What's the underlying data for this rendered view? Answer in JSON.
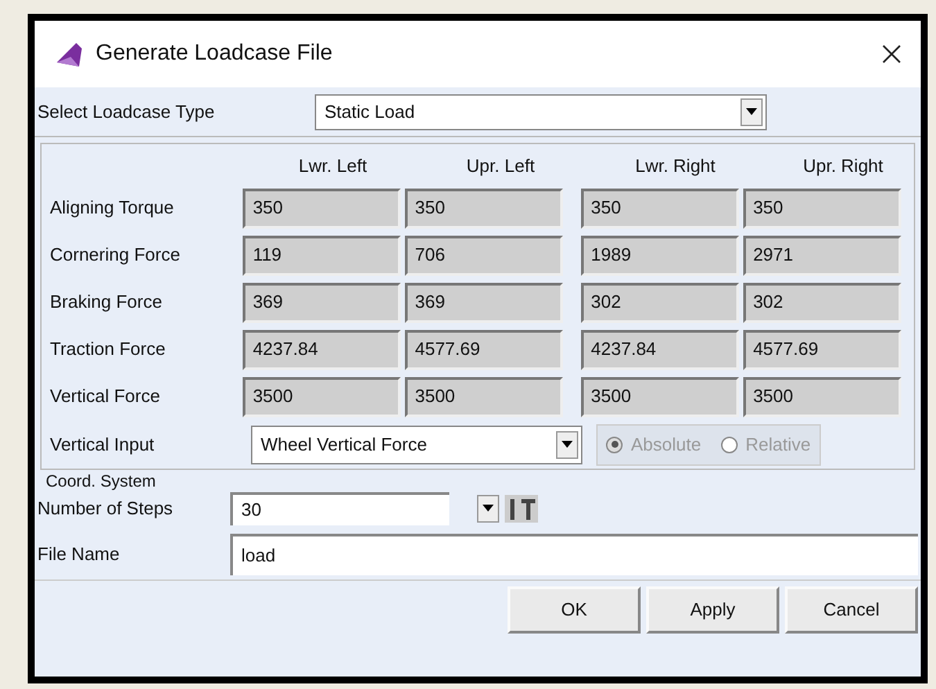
{
  "window": {
    "title": "Generate Loadcase File"
  },
  "loadcase_type": {
    "label": "Select Loadcase Type",
    "value": "Static Load"
  },
  "table": {
    "columns": [
      "Lwr. Left",
      "Upr. Left",
      "Lwr. Right",
      "Upr. Right"
    ],
    "rows": [
      {
        "label": "Aligning Torque",
        "values": [
          "350",
          "350",
          "350",
          "350"
        ]
      },
      {
        "label": "Cornering Force",
        "values": [
          "119",
          "706",
          "1989",
          "2971"
        ]
      },
      {
        "label": "Braking Force",
        "values": [
          "369",
          "369",
          "302",
          "302"
        ]
      },
      {
        "label": "Traction Force",
        "values": [
          "4237.84",
          "4577.69",
          "4237.84",
          "4577.69"
        ]
      },
      {
        "label": "Vertical Force",
        "values": [
          "3500",
          "3500",
          "3500",
          "3500"
        ]
      }
    ],
    "disabled": true
  },
  "vertical_input": {
    "label": "Vertical Input",
    "value": "Wheel Vertical Force",
    "options": [
      {
        "label": "Absolute",
        "selected": true,
        "disabled": true
      },
      {
        "label": "Relative",
        "selected": false,
        "disabled": true
      }
    ]
  },
  "coord_system": {
    "label": "Coord. System"
  },
  "number_of_steps": {
    "label": "Number of Steps",
    "value": "30"
  },
  "file_name": {
    "label": "File Name",
    "value": "load"
  },
  "buttons": [
    "OK",
    "Apply",
    "Cancel"
  ]
}
